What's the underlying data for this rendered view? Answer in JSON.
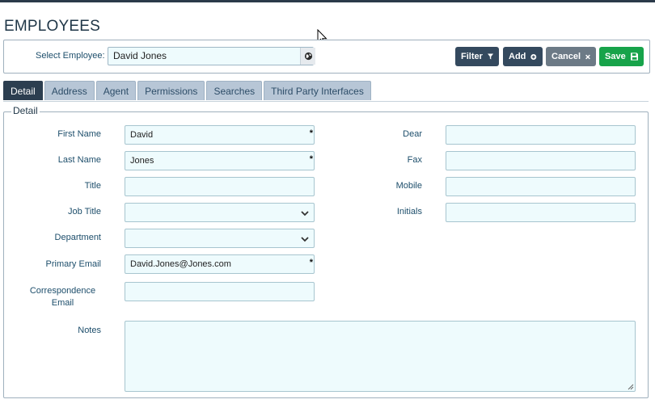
{
  "page": {
    "title": "EMPLOYEES"
  },
  "select_employee": {
    "label": "Select Employee:",
    "value": "David Jones"
  },
  "toolbar": {
    "filter": "Filter",
    "add": "Add",
    "cancel": "Cancel",
    "save": "Save"
  },
  "tabs": [
    "Detail",
    "Address",
    "Agent",
    "Permissions",
    "Searches",
    "Third Party Interfaces"
  ],
  "active_tab": "Detail",
  "section": {
    "legend": "Detail"
  },
  "fields": {
    "first_name": {
      "label": "First Name",
      "value": "David",
      "required": "*"
    },
    "last_name": {
      "label": "Last Name",
      "value": "Jones",
      "required": "*"
    },
    "title": {
      "label": "Title",
      "value": ""
    },
    "job_title": {
      "label": "Job Title",
      "value": ""
    },
    "department": {
      "label": "Department",
      "value": ""
    },
    "primary_email": {
      "label": "Primary Email",
      "value": "David.Jones@Jones.com",
      "required": "*"
    },
    "correspondence_email": {
      "label": "Correspondence Email",
      "value": ""
    },
    "notes": {
      "label": "Notes",
      "value": ""
    },
    "dear": {
      "label": "Dear",
      "value": ""
    },
    "fax": {
      "label": "Fax",
      "value": ""
    },
    "mobile": {
      "label": "Mobile",
      "value": ""
    },
    "initials": {
      "label": "Initials",
      "value": ""
    }
  },
  "colors": {
    "primary": "#34495e",
    "success": "#17a34a",
    "muted": "#6c7a86",
    "input_bg": "#eefbfd",
    "tab_active": "#2c3e50"
  },
  "icons": {
    "filter": "filter-icon",
    "add": "plus-circle-icon",
    "cancel": "close-icon",
    "save": "floppy-disk-icon",
    "globe": "globe-icon"
  }
}
